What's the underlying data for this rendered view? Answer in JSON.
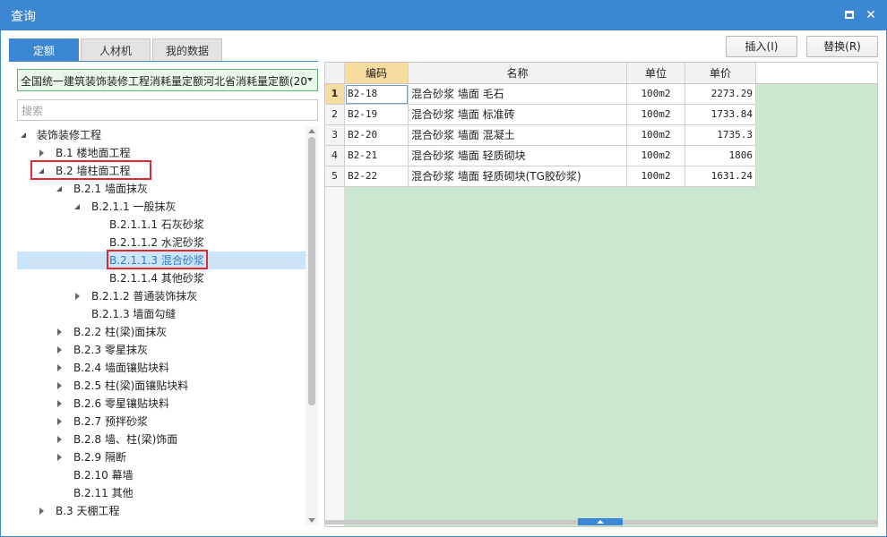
{
  "window": {
    "title": "查询"
  },
  "tabs": [
    {
      "label": "定额",
      "active": true
    },
    {
      "label": "人材机",
      "active": false
    },
    {
      "label": "我的数据",
      "active": false
    }
  ],
  "actions": {
    "insert_label": "插入(I)",
    "replace_label": "替换(R)"
  },
  "library": {
    "selected": "全国统一建筑装饰装修工程消耗量定额河北省消耗量定额(20"
  },
  "search": {
    "placeholder": "搜索",
    "value": ""
  },
  "tree": [
    {
      "label": "装饰装修工程",
      "state": "expanded"
    },
    {
      "label": "B.1 楼地面工程",
      "state": "collapsed"
    },
    {
      "label": "B.2 墙柱面工程",
      "state": "expanded",
      "highlighted": true
    },
    {
      "label": "B.2.1 墙面抹灰",
      "state": "expanded"
    },
    {
      "label": "B.2.1.1 一般抹灰",
      "state": "expanded"
    },
    {
      "label": "B.2.1.1.1 石灰砂浆",
      "state": "leaf"
    },
    {
      "label": "B.2.1.1.2 水泥砂浆",
      "state": "leaf"
    },
    {
      "label": "B.2.1.1.3 混合砂浆",
      "state": "leaf",
      "selected": true,
      "highlighted": true
    },
    {
      "label": "B.2.1.1.4 其他砂浆",
      "state": "leaf"
    },
    {
      "label": "B.2.1.2 普通装饰抹灰",
      "state": "collapsed"
    },
    {
      "label": "B.2.1.3 墙面勾缝",
      "state": "leaf"
    },
    {
      "label": "B.2.2 柱(梁)面抹灰",
      "state": "collapsed"
    },
    {
      "label": "B.2.3 零星抹灰",
      "state": "collapsed"
    },
    {
      "label": "B.2.4 墙面镶贴块料",
      "state": "collapsed"
    },
    {
      "label": "B.2.5 柱(梁)面镶贴块料",
      "state": "collapsed"
    },
    {
      "label": "B.2.6 零星镶贴块料",
      "state": "collapsed"
    },
    {
      "label": "B.2.7 预拌砂浆",
      "state": "collapsed"
    },
    {
      "label": "B.2.8 墙、柱(梁)饰面",
      "state": "collapsed"
    },
    {
      "label": "B.2.9 隔断",
      "state": "collapsed"
    },
    {
      "label": "B.2.10 幕墙",
      "state": "leaf"
    },
    {
      "label": "B.2.11 其他",
      "state": "leaf"
    },
    {
      "label": "B.3 天棚工程",
      "state": "collapsed"
    }
  ],
  "table": {
    "columns": [
      "编码",
      "名称",
      "单位",
      "单价"
    ],
    "rows": [
      {
        "no": "1",
        "code": "B2-18",
        "name": "混合砂浆 墙面 毛石",
        "unit": "100m2",
        "price": "2273.29"
      },
      {
        "no": "2",
        "code": "B2-19",
        "name": "混合砂浆 墙面 标准砖",
        "unit": "100m2",
        "price": "1733.84"
      },
      {
        "no": "3",
        "code": "B2-20",
        "name": "混合砂浆 墙面 混凝土",
        "unit": "100m2",
        "price": "1735.3"
      },
      {
        "no": "4",
        "code": "B2-21",
        "name": "混合砂浆 墙面 轻质砌块",
        "unit": "100m2",
        "price": "1806"
      },
      {
        "no": "5",
        "code": "B2-22",
        "name": "混合砂浆 墙面 轻质砌块(TG胶砂浆)",
        "unit": "100m2",
        "price": "1631.24"
      }
    ]
  },
  "colors": {
    "accent": "#3b87d4",
    "grid_bg": "#cbe7cf",
    "highlight": "#e0282e",
    "header_active": "#f7dca0"
  }
}
